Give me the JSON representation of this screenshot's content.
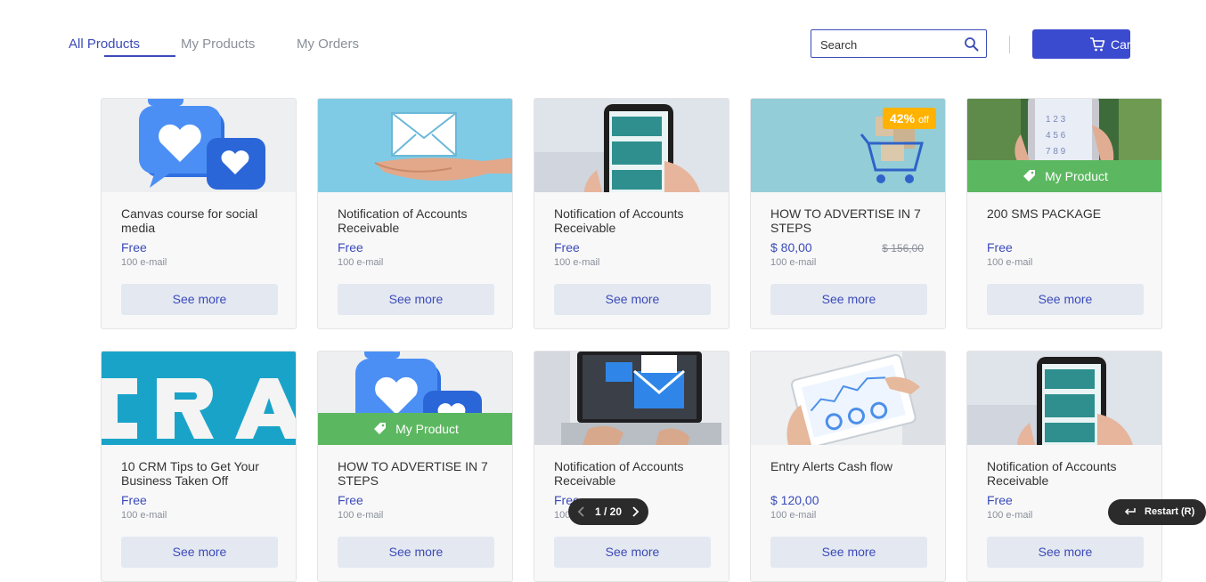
{
  "nav": {
    "tabs": [
      {
        "label": "All Products",
        "active": true
      },
      {
        "label": "My Products",
        "active": false
      },
      {
        "label": "My Orders",
        "active": false
      }
    ]
  },
  "search": {
    "placeholder": "Search",
    "icon": "search-icon"
  },
  "cart": {
    "label": "Car",
    "icon": "cart-icon"
  },
  "colors": {
    "accent": "#3b4bb8",
    "button": "#3b4bd0",
    "badge": "#5cb860",
    "discount": "#ffb300"
  },
  "products": [
    {
      "title": "Canvas course for social media",
      "price": "Free",
      "unit": "100 e-mail",
      "button": "See more",
      "image": "heart-chat-bubbles"
    },
    {
      "title": "Notification of Accounts Receivable",
      "price": "Free",
      "unit": "100 e-mail",
      "button": "See more",
      "image": "envelope-on-hand"
    },
    {
      "title": "Notification of Accounts Receivable",
      "price": "Free",
      "unit": "100 e-mail",
      "button": "See more",
      "image": "phone-chat"
    },
    {
      "title": "HOW TO ADVERTISE IN 7 STEPS",
      "price": "$ 80,00",
      "old_price": "$ 156,00",
      "discount_value": "42%",
      "discount_label": "off",
      "unit": "100 e-mail",
      "button": "See more",
      "image": "shopping-cart-boxes"
    },
    {
      "title": "200 SMS PACKAGE",
      "price": "Free",
      "unit": "100 e-mail",
      "button": "See more",
      "badge": "My Product",
      "image": "phone-keypad"
    },
    {
      "title": "10 CRM Tips to Get Your Business Taken Off",
      "price": "Free",
      "unit": "100 e-mail",
      "button": "See more",
      "image": "crm-letters"
    },
    {
      "title": "HOW TO ADVERTISE IN 7 STEPS",
      "price": "Free",
      "unit": "100 e-mail",
      "button": "See more",
      "badge": "My Product",
      "image": "heart-chat-bubbles"
    },
    {
      "title": "Notification of Accounts Receivable",
      "price": "Free",
      "unit": "100 e-mail",
      "button": "See more",
      "image": "laptop-envelopes"
    },
    {
      "title": "Entry Alerts Cash flow",
      "price": "$ 120,00",
      "unit": "100 e-mail",
      "button": "See more",
      "image": "tablet-dashboard"
    },
    {
      "title": "Notification of Accounts Receivable",
      "price": "Free",
      "unit": "100 e-mail",
      "button": "See more",
      "image": "phone-chat"
    }
  ],
  "pager": {
    "text": "1 / 20"
  },
  "restart": {
    "label": "Restart (R)"
  }
}
